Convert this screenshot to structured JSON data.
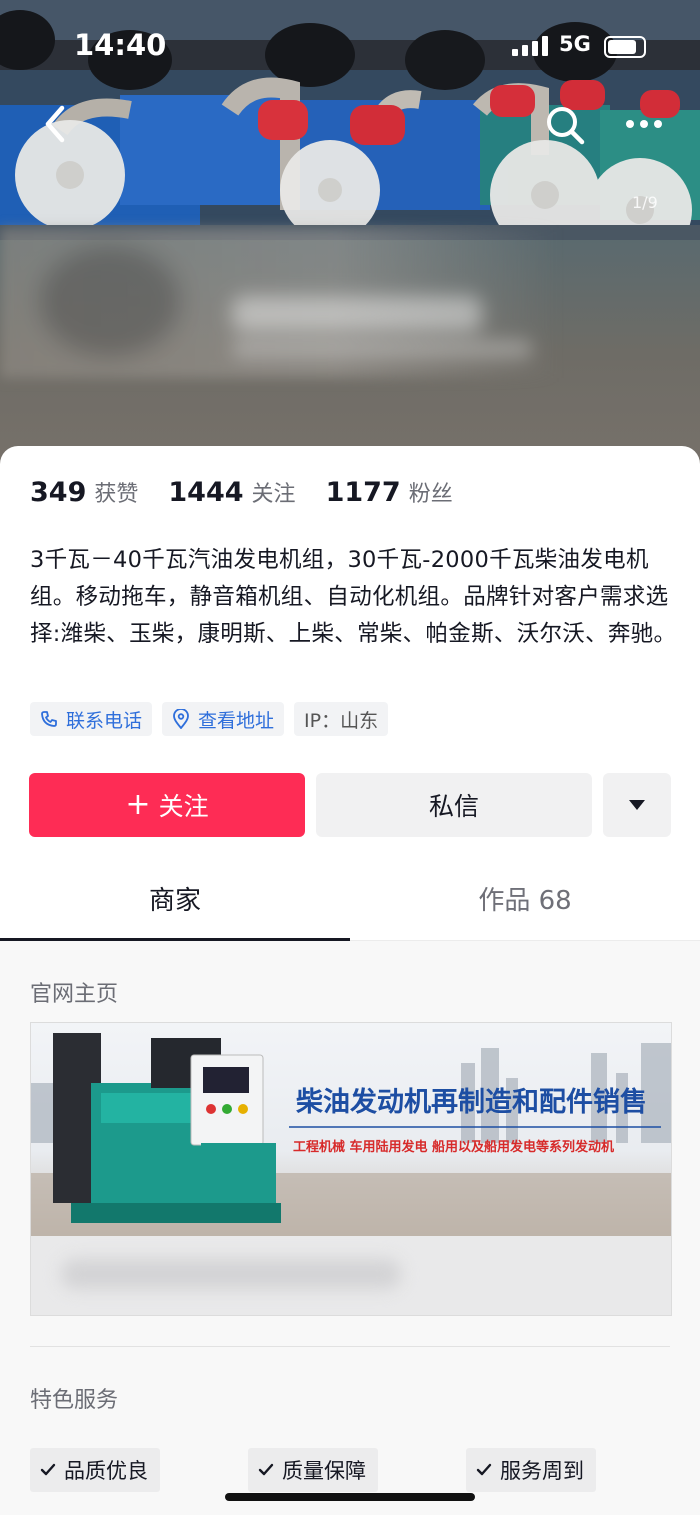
{
  "status_bar": {
    "time": "14:40",
    "network": "5G"
  },
  "header": {
    "photo_counter": "1/9"
  },
  "stats": [
    {
      "value": "349",
      "label": "获赞"
    },
    {
      "value": "1444",
      "label": "关注"
    },
    {
      "value": "1177",
      "label": "粉丝"
    }
  ],
  "bio": "3千瓦－40千瓦汽油发电机组，30千瓦-2000千瓦柴油发电机组。移动拖车，静音箱机组、自动化机组。品牌针对客户需求选择:潍柴、玉柴，康明斯、上柴、常柴、帕金斯、沃尔沃、奔驰。",
  "tags": {
    "phone": "联系电话",
    "address": "查看地址",
    "ip": "IP：山东"
  },
  "actions": {
    "follow": "关注",
    "message": "私信"
  },
  "tabs": {
    "merchant": "商家",
    "works": "作品 68"
  },
  "sections": {
    "official_site": "官网主页",
    "services_title": "特色服务"
  },
  "banner": {
    "headline": "柴油发动机再制造和配件销售",
    "subline": "工程机械 车用陆用发电 船用以及船用发电等系列发动机"
  },
  "services": [
    "品质优良",
    "质量保障",
    "服务周到"
  ],
  "colors": {
    "accent": "#fe2c55",
    "link": "#2f6fdb"
  }
}
